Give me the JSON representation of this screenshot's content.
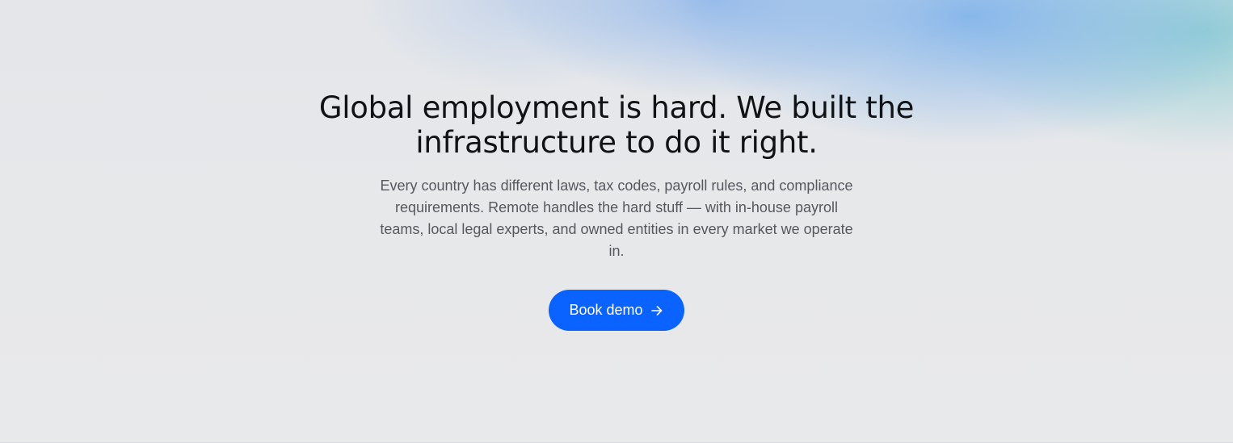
{
  "hero": {
    "headline": "Global employment is hard. We built the infrastructure to do it right.",
    "subtext": "Every country has different laws, tax codes, payroll rules, and compliance requirements. Remote handles the hard stuff — with in-house payroll teams, local legal experts, and owned entities in every market we operate in.",
    "cta": {
      "label": "Book demo",
      "icon": "arrow-right-icon"
    }
  },
  "colors": {
    "background": "#e7e8ea",
    "headline": "#111214",
    "subtext": "#55585e",
    "button": "#0a63ff",
    "button_text": "#ffffff",
    "gradient_blue": "#78afeb",
    "gradient_teal": "#8ccdd2"
  }
}
